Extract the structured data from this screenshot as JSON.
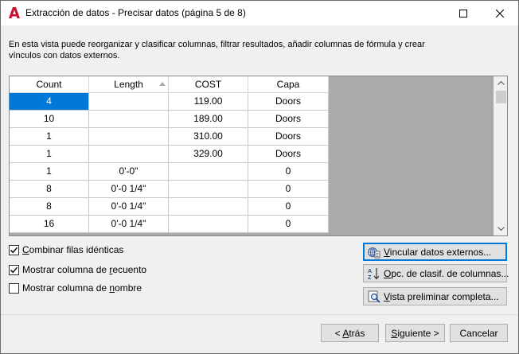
{
  "window": {
    "title": "Extracción de datos - Precisar datos (página 5 de 8)",
    "app_icon": "autocad-a-icon"
  },
  "description": "En esta vista puede reorganizar y clasificar columnas, filtrar resultados, añadir columnas de fórmula y crear vínculos con datos externos.",
  "table": {
    "columns": [
      "Count",
      "Length",
      "COST",
      "Capa"
    ],
    "sorted_column": "Length",
    "rows": [
      [
        "4",
        "",
        "119.00",
        "Doors"
      ],
      [
        "10",
        "",
        "189.00",
        "Doors"
      ],
      [
        "1",
        "",
        "310.00",
        "Doors"
      ],
      [
        "1",
        "",
        "329.00",
        "Doors"
      ],
      [
        "1",
        "0'-0\"",
        "",
        "0"
      ],
      [
        "8",
        "0'-0 1/4\"",
        "",
        "0"
      ],
      [
        "8",
        "0'-0 1/4\"",
        "",
        "0"
      ],
      [
        "16",
        "0'-0 1/4\"",
        "",
        "0"
      ]
    ],
    "selected_cell": "row 1, Count"
  },
  "options": {
    "combine": {
      "pre": "",
      "ul": "C",
      "post": "ombinar filas idénticas",
      "checked": true
    },
    "count_col": {
      "pre": "Mostrar columna de ",
      "ul": "r",
      "post": "ecuento",
      "checked": true
    },
    "name_col": {
      "pre": "Mostrar columna de ",
      "ul": "n",
      "post": "ombre",
      "checked": false
    }
  },
  "actions": {
    "link": {
      "pre": "",
      "ul": "V",
      "post": "incular datos externos..."
    },
    "sort": {
      "pre": "",
      "ul": "O",
      "post": "pc. de clasif. de columnas..."
    },
    "preview": {
      "pre": "",
      "ul": "V",
      "post": "ista preliminar completa..."
    }
  },
  "footer": {
    "back": {
      "pre": "< ",
      "ul": "A",
      "post": "trás"
    },
    "next": {
      "pre": "",
      "ul": "S",
      "post": "iguiente >"
    },
    "cancel": {
      "pre": "Cancelar",
      "ul": "",
      "post": ""
    }
  },
  "colors": {
    "selection": "#0078d7",
    "title_icon": "#c8102e",
    "grid_empty_area": "#aaaaaa"
  }
}
